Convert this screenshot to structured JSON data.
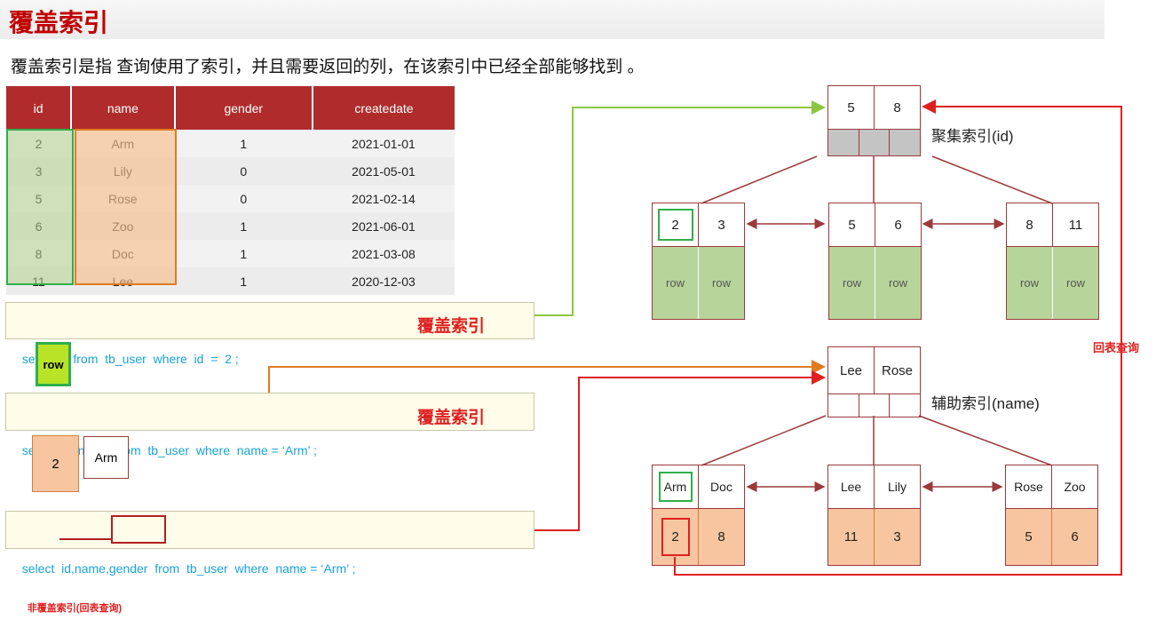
{
  "title": "覆盖索引",
  "subtitle": "覆盖索引是指 查询使用了索引，并且需要返回的列，在该索引中已经全部能够找到 。",
  "table": {
    "headers": [
      "id",
      "name",
      "gender",
      "createdate"
    ],
    "rows": [
      [
        "2",
        "Arm",
        "1",
        "2021-01-01"
      ],
      [
        "3",
        "Lily",
        "0",
        "2021-05-01"
      ],
      [
        "5",
        "Rose",
        "0",
        "2021-02-14"
      ],
      [
        "6",
        "Zoo",
        "1",
        "2021-06-01"
      ],
      [
        "8",
        "Doc",
        "1",
        "2021-03-08"
      ],
      [
        "11",
        "Lee",
        "1",
        "2020-12-03"
      ]
    ]
  },
  "queries": [
    {
      "sql": "select  *  from  tb_user  where  id  =  2 ;",
      "label": "覆盖索引"
    },
    {
      "sql": "select  id, name  from  tb_user  where  name = ‘Arm’ ;",
      "label": "覆盖索引"
    },
    {
      "sql": "select  id,name,gender  from  tb_user  where  name = ‘Arm’ ;",
      "label": "非覆盖索引(回表查询)"
    }
  ],
  "results": {
    "q1": "row",
    "q2": [
      "2",
      "Arm"
    ]
  },
  "clustered": {
    "caption": "聚集索引(id)",
    "root": [
      "5",
      "8"
    ],
    "leaves": [
      [
        "2",
        "3"
      ],
      [
        "5",
        "6"
      ],
      [
        "8",
        "11"
      ]
    ],
    "row_label": "row"
  },
  "secondary": {
    "caption": "辅助索引(name)",
    "root": [
      "Lee",
      "Rose"
    ],
    "leaves": [
      [
        "Arm",
        "Doc"
      ],
      [
        "Lee",
        "Lily"
      ],
      [
        "Rose",
        "Zoo"
      ]
    ],
    "leaf_ids": [
      [
        "2",
        "8"
      ],
      [
        "11",
        "3"
      ],
      [
        "5",
        "6"
      ]
    ]
  },
  "back_query_label": "回表查询",
  "colors": {
    "accent": "#c00000",
    "header": "#b02c2c",
    "sql": "#1aa3d9",
    "green": "#2fae4a",
    "orange": "#e07b20",
    "red": "#e02020"
  }
}
